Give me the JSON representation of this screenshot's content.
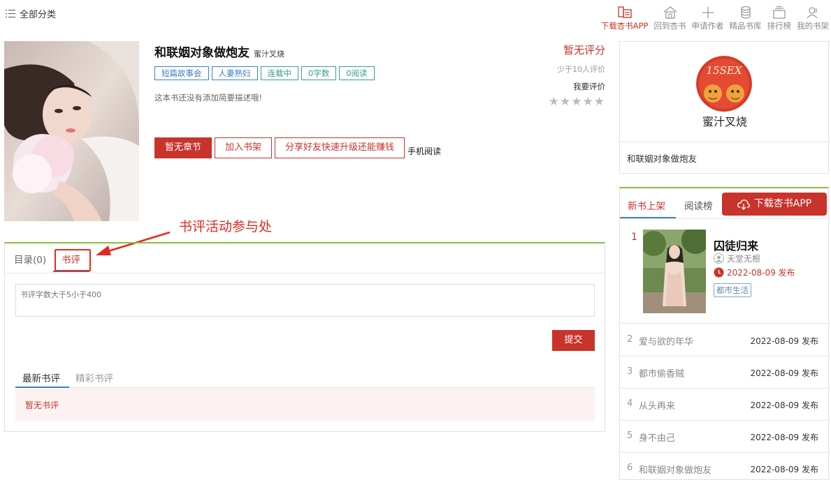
{
  "header": {
    "all_categories": "全部分类",
    "nav": [
      {
        "label": "下载杏书APP",
        "icon": "phone-book-icon"
      },
      {
        "label": "回到杏书",
        "icon": "home-icon"
      },
      {
        "label": "申请作者",
        "icon": "plus-icon"
      },
      {
        "label": "精品书库",
        "icon": "database-icon"
      },
      {
        "label": "排行榜",
        "icon": "ranking-icon"
      },
      {
        "label": "我的书架",
        "icon": "user-icon"
      }
    ]
  },
  "book": {
    "title": "和联姻对象做炮友",
    "author": "蜜汁叉烧",
    "tags": [
      "短篇故事会",
      "人妻熟妇",
      "连载中",
      "0字数",
      "0阅读"
    ],
    "description": "这本书还没有添加简要描述哦!",
    "rating": {
      "no_score": "暂无评分",
      "few_eval": "少于10人评价",
      "my_eval": "我要评价",
      "stars": "★★★★★"
    },
    "actions": {
      "no_chapter": "暂无章节",
      "add_shelf": "加入书架",
      "share": "分享好友快速升级还能赚钱",
      "mobile_read": "手机阅读"
    }
  },
  "annotation": {
    "text": "书评活动参与处"
  },
  "content": {
    "tabs": {
      "catalog": "目录(0)",
      "review": "书评"
    },
    "review_placeholder": "书评字数大于5小于400",
    "submit_label": "提交",
    "review_tabs": {
      "latest": "最新书评",
      "featured": "精彩书评"
    },
    "empty_text": "暂无书评"
  },
  "author_card": {
    "name": "蜜汁叉烧",
    "book": "和联姻对象做炮友",
    "avatar_text": "15SEX"
  },
  "ranking": {
    "tabs": {
      "new": "新书上架",
      "reads": "阅读榜"
    },
    "download_label": "下载杏书APP",
    "first": {
      "rank": "1",
      "title": "囚徒归来",
      "author": "天堂无根",
      "date": "2022-08-09 发布",
      "genre": "都市生活"
    },
    "items": [
      {
        "rank": "2",
        "title": "爱与欲的年华",
        "date": "2022-08-09 发布"
      },
      {
        "rank": "3",
        "title": "都市偷香贼",
        "date": "2022-08-09 发布"
      },
      {
        "rank": "4",
        "title": "从头再来",
        "date": "2022-08-09 发布"
      },
      {
        "rank": "5",
        "title": "身不由己",
        "date": "2022-08-09 发布"
      },
      {
        "rank": "6",
        "title": "和联姻对象做炮友",
        "date": "2022-08-09 发布"
      }
    ]
  },
  "colors": {
    "accent": "#c8332b",
    "link_blue": "#3b7fc4",
    "green_border": "#8abf3e",
    "annotation_red": "#e32a1e"
  }
}
